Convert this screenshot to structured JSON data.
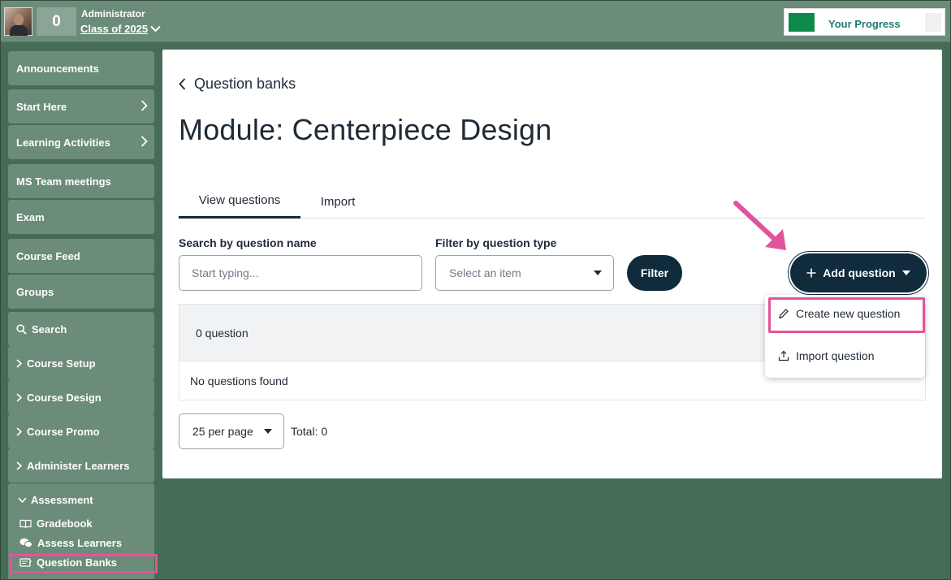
{
  "header": {
    "points": "0",
    "user_role": "Administrator",
    "class_label": "Class of 2025",
    "progress_label": "Your Progress",
    "progress_color": "#0d8a4a"
  },
  "sidebar": {
    "items": [
      {
        "label": "Announcements"
      },
      {
        "label": "Start Here"
      },
      {
        "label": "Learning Activities"
      },
      {
        "label": "MS Team meetings"
      },
      {
        "label": "Exam"
      },
      {
        "label": "Course Feed"
      },
      {
        "label": "Groups"
      },
      {
        "label": "Search"
      },
      {
        "label": "Course Setup"
      },
      {
        "label": "Course Design"
      },
      {
        "label": "Course Promo"
      },
      {
        "label": "Administer Learners"
      }
    ],
    "assessment": {
      "label": "Assessment",
      "children": [
        {
          "label": "Gradebook"
        },
        {
          "label": "Assess Learners"
        },
        {
          "label": "Question Banks"
        }
      ]
    }
  },
  "main": {
    "back_label": "Question banks",
    "title": "Module: Centerpiece Design",
    "tabs": [
      {
        "label": "View questions",
        "active": true
      },
      {
        "label": "Import",
        "active": false
      }
    ],
    "search": {
      "label": "Search by question name",
      "placeholder": "Start typing..."
    },
    "filter_type": {
      "label": "Filter by question type",
      "selected": "Select an item"
    },
    "filter_button": "Filter",
    "add_button": "Add question",
    "add_menu": [
      {
        "label": "Create new question",
        "icon": "pencil-icon"
      },
      {
        "label": "Import question",
        "icon": "upload-icon"
      }
    ],
    "table": {
      "count_label": "0 question",
      "empty_message": "No questions found"
    },
    "pagination": {
      "per_page": "25 per page",
      "total": "Total: 0"
    }
  },
  "colors": {
    "accent_dark": "#0f2b3c",
    "highlight": "#e0559a",
    "sidebar_bg": "#6b8c78",
    "page_bg": "#466b56"
  }
}
